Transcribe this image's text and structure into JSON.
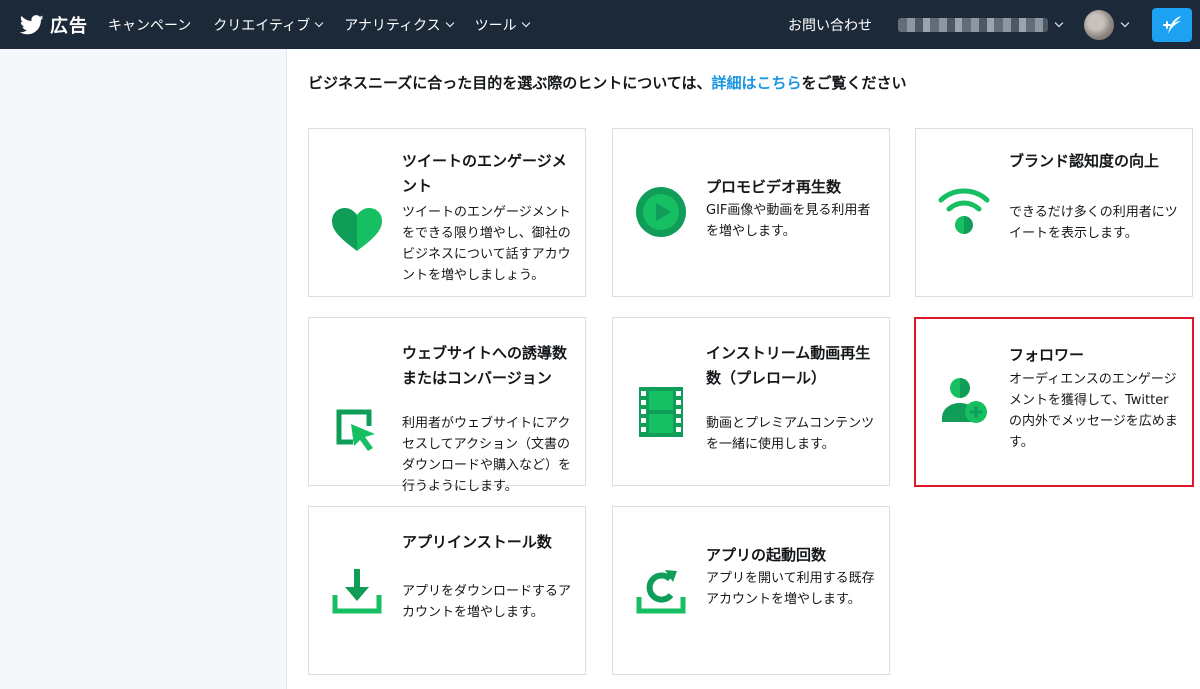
{
  "header": {
    "brand_label": "広告",
    "nav": [
      {
        "label": "キャンペーン",
        "has_menu": false
      },
      {
        "label": "クリエイティブ",
        "has_menu": true
      },
      {
        "label": "アナリティクス",
        "has_menu": true
      },
      {
        "label": "ツール",
        "has_menu": true
      }
    ],
    "contact_label": "お問い合わせ",
    "icons": {
      "brand": "twitter-bird-icon",
      "compose": "compose-icon"
    }
  },
  "main": {
    "hint_prefix": "ビジネスニーズに合った目的を選ぶ際のヒントについては、",
    "hint_link": "詳細はこちら",
    "hint_suffix": "をご覧ください"
  },
  "objectives": [
    {
      "title": "ツイートのエンゲージメント",
      "description": "ツイートのエンゲージメントをできる限り増やし、御社のビジネスについて話すアカウントを増やしましょう。",
      "icon": "heart-icon",
      "selected": false
    },
    {
      "title": "プロモビデオ再生数",
      "description": "GIF画像や動画を見る利用者を増やします。",
      "icon": "play-circle-icon",
      "selected": false
    },
    {
      "title": "ブランド認知度の向上",
      "description": "できるだけ多くの利用者にツイートを表示します。",
      "icon": "broadcast-icon",
      "selected": false
    },
    {
      "title": "ウェブサイトへの誘導数またはコンバージョン",
      "description": "利用者がウェブサイトにアクセスしてアクション（文書のダウンロードや購入など）を行うようにします。",
      "icon": "cursor-click-icon",
      "selected": false
    },
    {
      "title": "インストリーム動画再生数（プレロール）",
      "description": "動画とプレミアムコンテンツを一緒に使用します。",
      "icon": "film-strip-icon",
      "selected": false
    },
    {
      "title": "フォロワー",
      "description": "オーディエンスのエンゲージメントを獲得して、Twitterの内外でメッセージを広めます。",
      "icon": "add-follower-icon",
      "selected": true
    },
    {
      "title": "アプリインストール数",
      "description": "アプリをダウンロードするアカウントを増やします。",
      "icon": "download-icon",
      "selected": false
    },
    {
      "title": "アプリの起動回数",
      "description": "アプリを開いて利用する既存アカウントを増やします。",
      "icon": "refresh-icon",
      "selected": false
    }
  ],
  "colors": {
    "topbar": "#1c2938",
    "accent_green": "#17bf63",
    "link_blue": "#1b95e0",
    "selected_border": "#e0162b"
  }
}
